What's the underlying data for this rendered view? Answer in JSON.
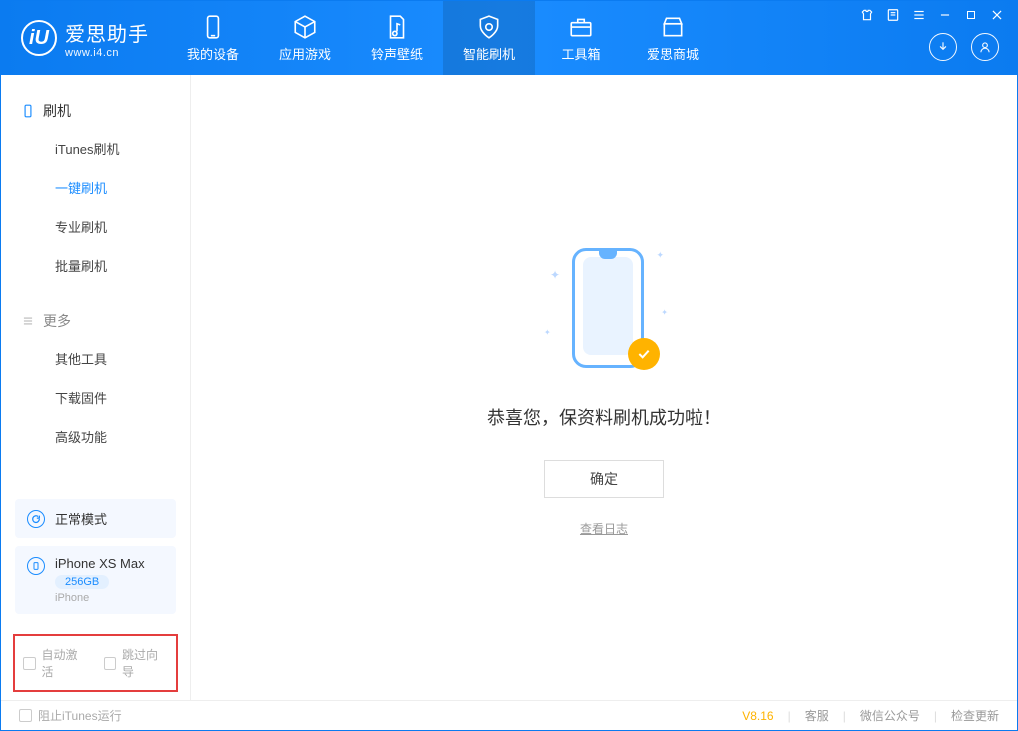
{
  "logo": {
    "glyph": "iU",
    "name_cn": "爱思助手",
    "url": "www.i4.cn"
  },
  "tabs": [
    {
      "label": "我的设备"
    },
    {
      "label": "应用游戏"
    },
    {
      "label": "铃声壁纸"
    },
    {
      "label": "智能刷机"
    },
    {
      "label": "工具箱"
    },
    {
      "label": "爱思商城"
    }
  ],
  "sidebar": {
    "group1": {
      "title": "刷机",
      "items": [
        "iTunes刷机",
        "一键刷机",
        "专业刷机",
        "批量刷机"
      ]
    },
    "group2": {
      "title": "更多",
      "items": [
        "其他工具",
        "下载固件",
        "高级功能"
      ]
    }
  },
  "device_status": {
    "mode": "正常模式"
  },
  "device": {
    "name": "iPhone XS Max",
    "capacity": "256GB",
    "type": "iPhone"
  },
  "options": {
    "auto_activate": "自动激活",
    "skip_guide": "跳过向导"
  },
  "result": {
    "title": "恭喜您，保资料刷机成功啦！",
    "ok": "确定",
    "log": "查看日志"
  },
  "footer": {
    "block_itunes": "阻止iTunes运行",
    "version": "V8.16",
    "cs": "客服",
    "wechat": "微信公众号",
    "update": "检查更新"
  }
}
